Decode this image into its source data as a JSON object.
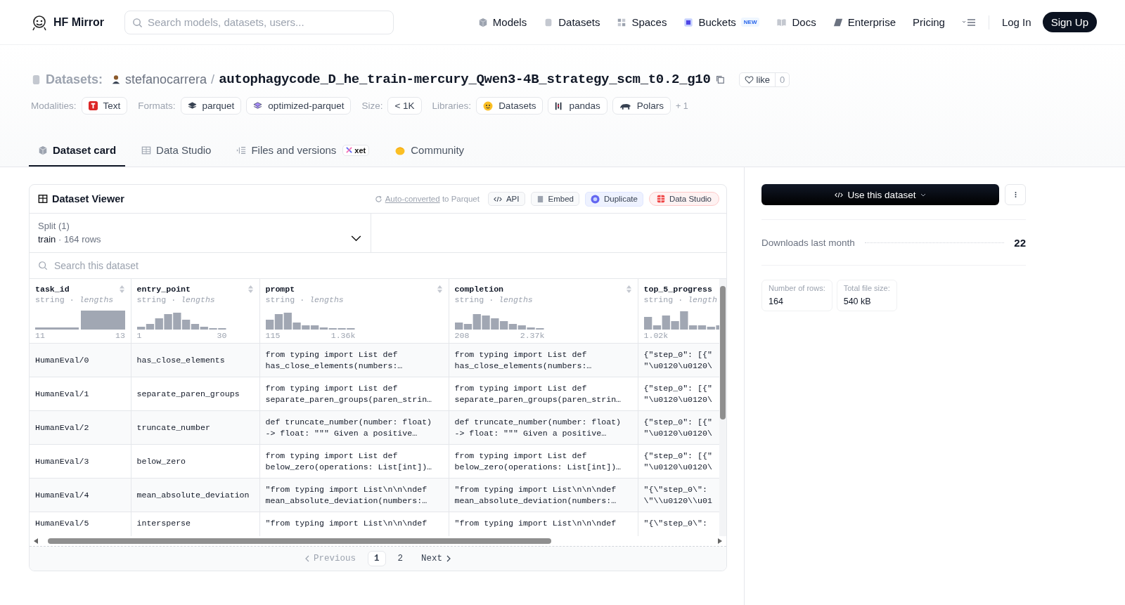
{
  "header": {
    "brand": "HF Mirror",
    "search_placeholder": "Search models, datasets, users...",
    "nav": [
      {
        "label": "Models"
      },
      {
        "label": "Datasets"
      },
      {
        "label": "Spaces"
      },
      {
        "label": "Buckets",
        "badge": "NEW"
      },
      {
        "label": "Docs"
      },
      {
        "label": "Enterprise"
      },
      {
        "label": "Pricing"
      }
    ],
    "login": "Log In",
    "signup": "Sign Up"
  },
  "repo": {
    "section": "Datasets:",
    "owner": "stefanocarrera",
    "sep": "/",
    "name": "autophagycode_D_he_train-mercury_Qwen3-4B_strategy_scm_t0.2_g10",
    "like": "like",
    "likes": "0"
  },
  "tag_groups": [
    {
      "label": "Modalities:",
      "tags": [
        "Text"
      ]
    },
    {
      "label": "Formats:",
      "tags": [
        "parquet",
        "optimized-parquet"
      ]
    },
    {
      "label": "Size:",
      "tags": [
        "< 1K"
      ]
    },
    {
      "label": "Libraries:",
      "tags": [
        "Datasets",
        "pandas",
        "Polars"
      ],
      "more": "+ 1"
    }
  ],
  "tabs": [
    {
      "label": "Dataset card",
      "selected": true
    },
    {
      "label": "Data Studio",
      "selected": false
    },
    {
      "label": "Files and versions",
      "selected": false,
      "badge": "xet"
    },
    {
      "label": "Community",
      "selected": false
    }
  ],
  "viewer": {
    "title": "Dataset Viewer",
    "converted_link": "Auto-converted",
    "converted_rest": "to Parquet",
    "buttons": [
      "API",
      "Embed",
      "Duplicate",
      "Data Studio"
    ],
    "split": {
      "label": "Split (1)",
      "name": "train",
      "sep": "·",
      "rows": "164 rows"
    },
    "search_placeholder": "Search this dataset",
    "table": {
      "columns": [
        {
          "name": "task_id",
          "meta": "string · *lengths*",
          "min": "11",
          "max": "13"
        },
        {
          "name": "entry_point",
          "meta": "string · *lengths*",
          "min": "1",
          "max": "30"
        },
        {
          "name": "prompt",
          "meta": "string · *lengths*",
          "min": "115",
          "max": "1.36k"
        },
        {
          "name": "completion",
          "meta": "string · *lengths*",
          "min": "208",
          "max": "2.37k"
        },
        {
          "name": "top_5_progress",
          "meta": "string · *length*",
          "min": "1.02k"
        }
      ],
      "rows": [
        [
          "HumanEval/0",
          "has_close_elements",
          "from typing import List def\nhas_close_elements(numbers:…",
          "from typing import List def\nhas_close_elements(numbers:…",
          "{\"step_0\": [{\"\n\"\\u0120\\u0120\\"
        ],
        [
          "HumanEval/1",
          "separate_paren_groups",
          "from typing import List def\nseparate_paren_groups(paren_strin…",
          "from typing import List def\nseparate_paren_groups(paren_strin…",
          "{\"step_0\": [{\"\n\"\\u0120\\u0120\\"
        ],
        [
          "HumanEval/2",
          "truncate_number",
          "def truncate_number(number: float)\n-> float: \"\"\" Given a positive…",
          "def truncate_number(number: float)\n-> float: \"\"\" Given a positive…",
          "{\"step_0\": [{\"\n\"\\u0120\\u0120\\"
        ],
        [
          "HumanEval/3",
          "below_zero",
          "from typing import List def\nbelow_zero(operations: List[int])…",
          "from typing import List def\nbelow_zero(operations: List[int])…",
          "{\"step_0\": [{\"\n\"\\u0120\\u0120\\"
        ],
        [
          "HumanEval/4",
          "mean_absolute_deviation",
          "\"from typing import List\\n\\n\\ndef\nmean_absolute_deviation(numbers:…",
          "\"from typing import List\\n\\n\\ndef\nmean_absolute_deviation(numbers:…",
          "\"{\\\"step_0\\\":\n\\\"\\\\u0120\\\\u01"
        ],
        [
          "HumanEval/5",
          "intersperse",
          "\"from typing import List\\n\\n\\ndef",
          "\"from typing import List\\n\\n\\ndef",
          "\"{\\\"step_0\\\":"
        ]
      ]
    },
    "pagination": [
      {
        "label": "Previous",
        "kind": "prev",
        "disabled": true
      },
      {
        "label": "1",
        "kind": "page",
        "selected": true
      },
      {
        "label": "2",
        "kind": "page",
        "selected": false
      },
      {
        "label": "Next",
        "kind": "next",
        "disabled": false
      }
    ]
  },
  "sidebar": {
    "use_button": "Use this dataset",
    "downloads_label": "Downloads last month",
    "downloads": "22",
    "stats": [
      {
        "label": "Number of rows:",
        "value": "164"
      },
      {
        "label": "Total file size:",
        "value": "540 kB"
      }
    ]
  }
}
